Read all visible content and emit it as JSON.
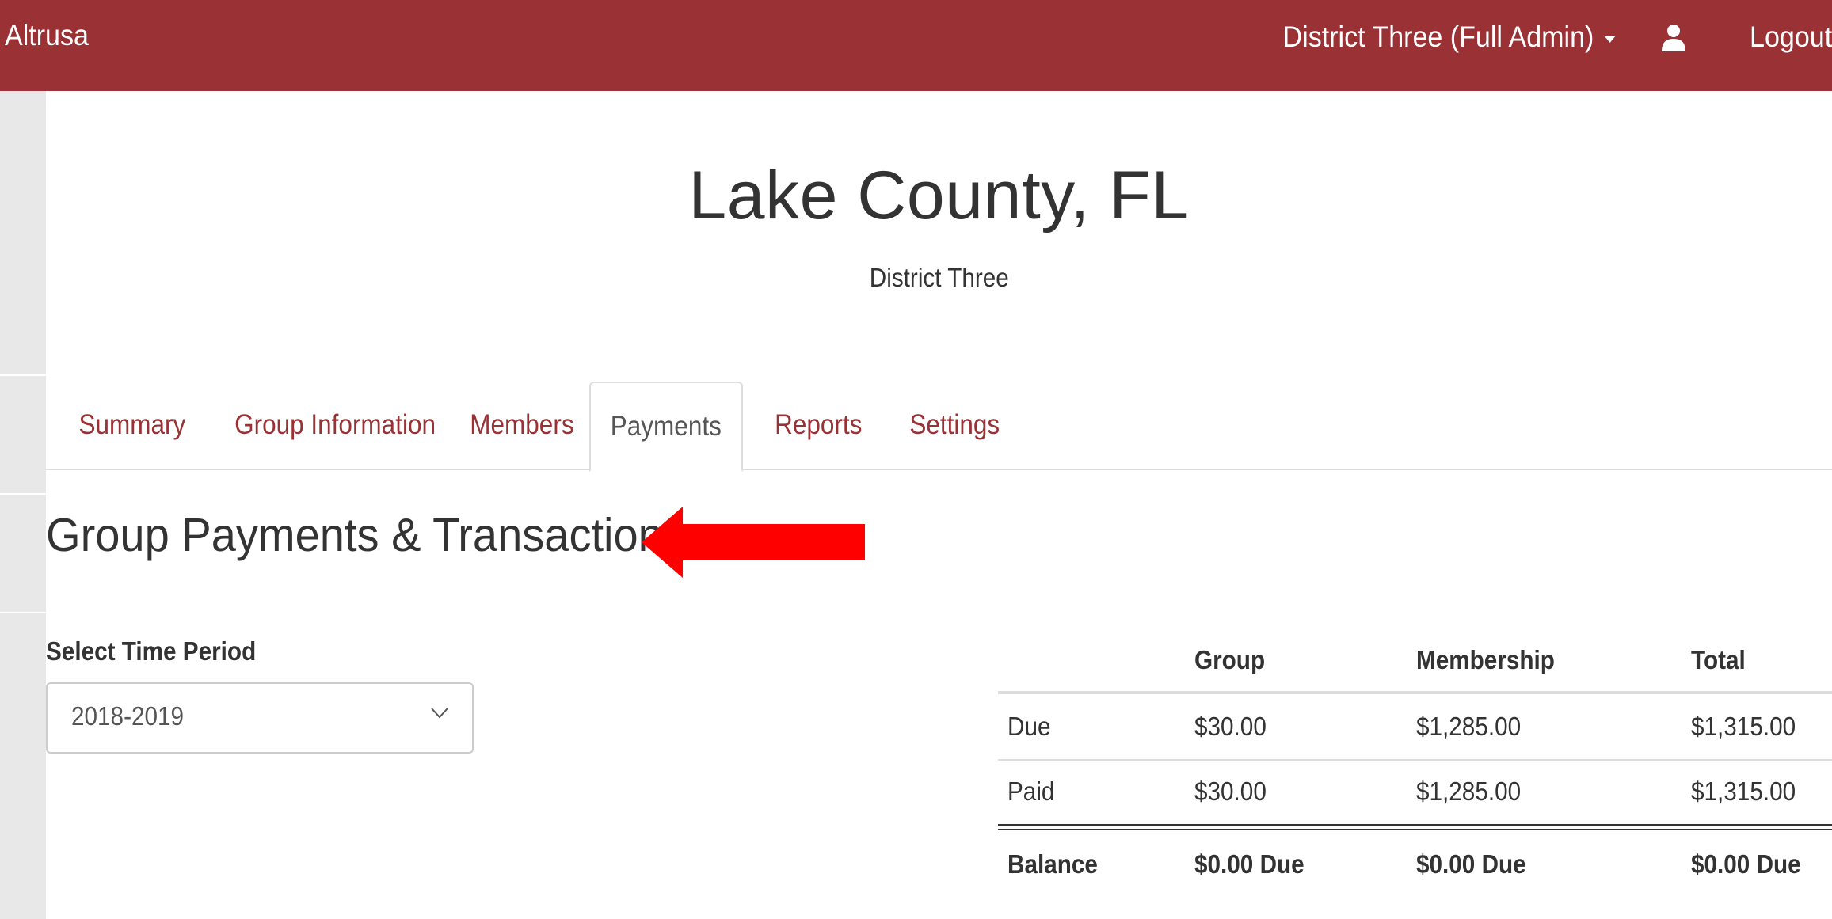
{
  "navbar": {
    "brand": "Altrusa",
    "account_label": "District Three (Full Admin)",
    "user_icon": "user-icon",
    "logout_label": "Logout",
    "background_color": "#993135"
  },
  "header": {
    "title": "Lake County, FL",
    "subtitle": "District Three"
  },
  "tabs": [
    {
      "label": "Summary",
      "active": false
    },
    {
      "label": "Group Information",
      "active": false
    },
    {
      "label": "Members",
      "active": false
    },
    {
      "label": "Payments",
      "active": true
    },
    {
      "label": "Reports",
      "active": false
    },
    {
      "label": "Settings",
      "active": false
    }
  ],
  "section": {
    "heading": "Group Payments & Transactions",
    "annotation": "red-arrow-icon"
  },
  "period": {
    "label": "Select Time Period",
    "selected": "2018-2019"
  },
  "summary_table": {
    "columns": [
      "",
      "Group",
      "Membership",
      "Total"
    ],
    "rows": [
      [
        "Due",
        "$30.00",
        "$1,285.00",
        "$1,315.00"
      ],
      [
        "Paid",
        "$30.00",
        "$1,285.00",
        "$1,315.00"
      ]
    ],
    "footer": [
      "Balance",
      "$0.00 Due",
      "$0.00 Due",
      "$0.00 Due"
    ]
  },
  "colors": {
    "accent": "#993135",
    "arrow": "#ff0000",
    "text": "#333333"
  }
}
